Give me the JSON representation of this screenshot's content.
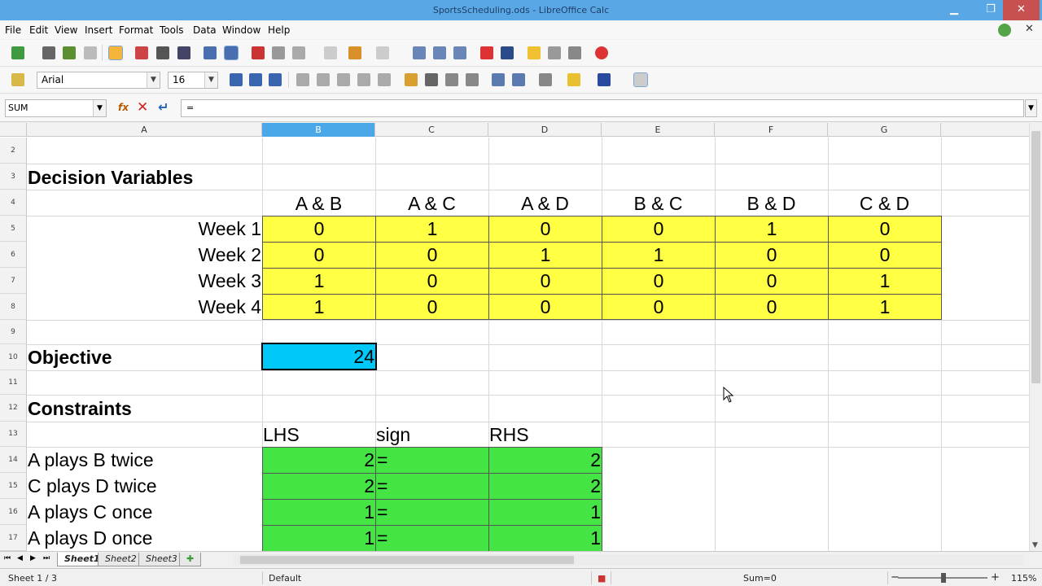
{
  "window": {
    "title": "SportsScheduling.ods - LibreOffice Calc",
    "close_glyph": "✕",
    "minimize_glyph": "▁",
    "maximize_glyph": "❐"
  },
  "menu": [
    "File",
    "Edit",
    "View",
    "Insert",
    "Format",
    "Tools",
    "Data",
    "Window",
    "Help"
  ],
  "doc_close_glyph": "✕",
  "toolbar": {
    "font_name": "Arial",
    "font_size": "16"
  },
  "formula_bar": {
    "name_box": "SUM",
    "fx_glyph": "fx",
    "cancel_glyph": "✕",
    "accept_glyph": "↵",
    "content": "="
  },
  "columns": [
    "A",
    "B",
    "C",
    "D",
    "E",
    "F",
    "G"
  ],
  "selected_column": "B",
  "rows": [
    "2",
    "3",
    "4",
    "5",
    "6",
    "7",
    "8",
    "9",
    "10",
    "11",
    "12",
    "13",
    "14",
    "15",
    "16",
    "17"
  ],
  "sheet": {
    "decision_title": "Decision Variables",
    "pairs": [
      "A & B",
      "A & C",
      "A & D",
      "B & C",
      "B & D",
      "C & D"
    ],
    "weeks": [
      {
        "label": "Week 1",
        "values": [
          "0",
          "1",
          "0",
          "0",
          "1",
          "0"
        ]
      },
      {
        "label": "Week 2",
        "values": [
          "0",
          "0",
          "1",
          "1",
          "0",
          "0"
        ]
      },
      {
        "label": "Week 3",
        "values": [
          "1",
          "0",
          "0",
          "0",
          "0",
          "1"
        ]
      },
      {
        "label": "Week 4",
        "values": [
          "1",
          "0",
          "0",
          "0",
          "0",
          "1"
        ]
      }
    ],
    "objective_label": "Objective",
    "objective_value": "24",
    "constraints_title": "Constraints",
    "constraint_headers": [
      "LHS",
      "sign",
      "RHS"
    ],
    "constraints": [
      {
        "label": "A plays B twice",
        "lhs": "2",
        "sign": "=",
        "rhs": "2"
      },
      {
        "label": "C plays D twice",
        "lhs": "2",
        "sign": "=",
        "rhs": "2"
      },
      {
        "label": "A plays C once",
        "lhs": "1",
        "sign": "=",
        "rhs": "1"
      },
      {
        "label": "A plays D once",
        "lhs": "1",
        "sign": "=",
        "rhs": "1"
      }
    ]
  },
  "tabs": {
    "nav_glyphs": [
      "⏮",
      "◀",
      "▶",
      "⏭"
    ],
    "sheets": [
      "Sheet1",
      "Sheet2",
      "Sheet3"
    ],
    "add_glyph": "✚",
    "active": "Sheet1"
  },
  "status": {
    "sheet_position": "Sheet 1 / 3",
    "page_style": "Default",
    "sum": "Sum=0",
    "zoom": "115%"
  },
  "colors": {
    "yellow": "#ffff44",
    "green": "#44e444",
    "cyan": "#00c8f8",
    "header_selected": "#4aa8e8"
  }
}
